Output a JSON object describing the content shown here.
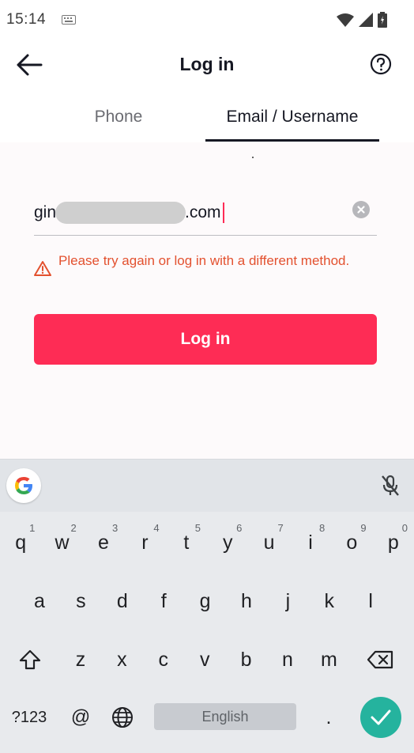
{
  "status": {
    "time": "15:14"
  },
  "header": {
    "title": "Log in"
  },
  "tabs": [
    {
      "label": "Phone"
    },
    {
      "label": "Email / Username"
    }
  ],
  "email": {
    "prefix": "gin",
    "suffix": ".com"
  },
  "error": {
    "message": "Please try again or log in with a different method."
  },
  "login_button": {
    "label": "Log in"
  },
  "keyboard": {
    "row1": [
      {
        "k": "q",
        "s": "1"
      },
      {
        "k": "w",
        "s": "2"
      },
      {
        "k": "e",
        "s": "3"
      },
      {
        "k": "r",
        "s": "4"
      },
      {
        "k": "t",
        "s": "5"
      },
      {
        "k": "y",
        "s": "6"
      },
      {
        "k": "u",
        "s": "7"
      },
      {
        "k": "i",
        "s": "8"
      },
      {
        "k": "o",
        "s": "9"
      },
      {
        "k": "p",
        "s": "0"
      }
    ],
    "row2": [
      "a",
      "s",
      "d",
      "f",
      "g",
      "h",
      "j",
      "k",
      "l"
    ],
    "row3": [
      "z",
      "x",
      "c",
      "v",
      "b",
      "n",
      "m"
    ],
    "symbols_key": "?123",
    "at_key": "@",
    "period_key": ".",
    "space_label": "English"
  },
  "colors": {
    "accent": "#fe2c55",
    "error": "#e3512f",
    "enter": "#25b39e"
  }
}
